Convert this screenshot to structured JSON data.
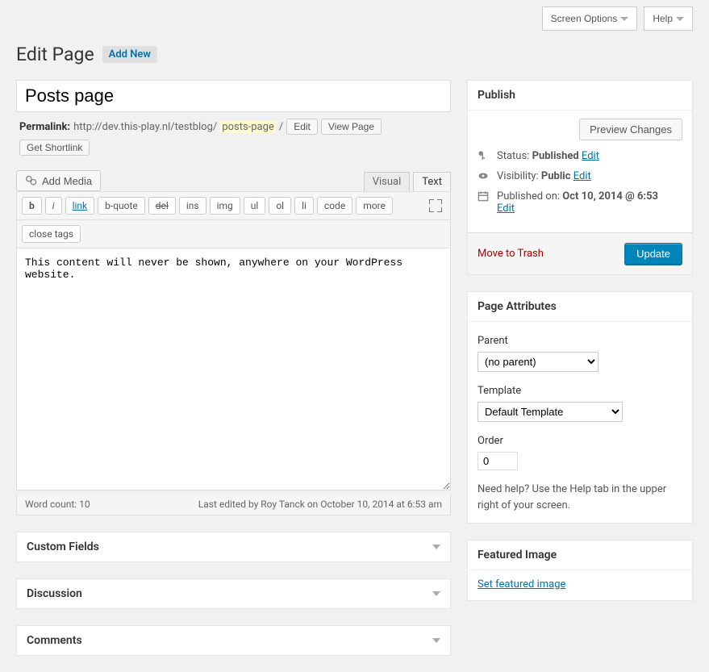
{
  "topbar": {
    "screen_options": "Screen Options",
    "help": "Help"
  },
  "header": {
    "title": "Edit Page",
    "add_new": "Add New"
  },
  "post": {
    "title": "Posts page",
    "permalink_label": "Permalink:",
    "permalink_base": "http://dev.this-play.nl/testblog/",
    "permalink_slug": "posts-page",
    "permalink_trail": "/",
    "edit_btn": "Edit",
    "view_btn": "View Page",
    "shortlink_btn": "Get Shortlink"
  },
  "editor": {
    "add_media": "Add Media",
    "tab_visual": "Visual",
    "tab_text": "Text",
    "buttons": {
      "b": "b",
      "i": "i",
      "link": "link",
      "bquote": "b-quote",
      "del": "del",
      "ins": "ins",
      "img": "img",
      "ul": "ul",
      "ol": "ol",
      "li": "li",
      "code": "code",
      "more": "more",
      "close": "close tags"
    },
    "content": "This content will never be shown, anywhere on your WordPress website.",
    "word_count": "Word count: 10",
    "last_edited": "Last edited by Roy Tanck on October 10, 2014 at 6:53 am"
  },
  "metaboxes": {
    "custom_fields": "Custom Fields",
    "discussion": "Discussion",
    "comments": "Comments"
  },
  "publish": {
    "title": "Publish",
    "preview": "Preview Changes",
    "status_label": "Status:",
    "status_value": "Published",
    "edit": "Edit",
    "visibility_label": "Visibility:",
    "visibility_value": "Public",
    "published_label": "Published on:",
    "published_value": "Oct 10, 2014 @ 6:53",
    "trash": "Move to Trash",
    "update": "Update"
  },
  "page_attributes": {
    "title": "Page Attributes",
    "parent_label": "Parent",
    "parent_value": "(no parent)",
    "template_label": "Template",
    "template_value": "Default Template",
    "order_label": "Order",
    "order_value": "0",
    "help": "Need help? Use the Help tab in the upper right of your screen."
  },
  "featured": {
    "title": "Featured Image",
    "set": "Set featured image"
  }
}
